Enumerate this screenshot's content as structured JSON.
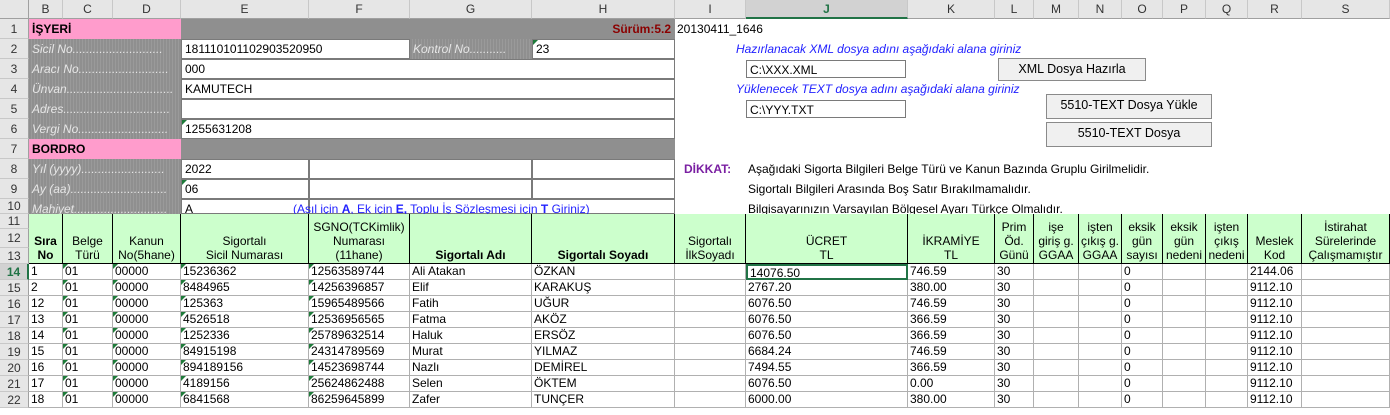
{
  "columns": [
    "B",
    "C",
    "D",
    "E",
    "F",
    "G",
    "H",
    "I",
    "J",
    "K",
    "L",
    "M",
    "N",
    "O",
    "P",
    "Q",
    "R",
    "S"
  ],
  "selected_column": "J",
  "row_numbers": [
    "1",
    "2",
    "3",
    "4",
    "5",
    "6",
    "7",
    "8",
    "9",
    "10",
    "11",
    "12",
    "13",
    "14",
    "15",
    "16",
    "17",
    "18",
    "19",
    "20",
    "21",
    "22"
  ],
  "selected_row": "14",
  "isyeri": {
    "title": "İŞYERİ",
    "sicil_label": "Sicil No...........................",
    "sicil_value": "181110101102903520950",
    "kontrol_label": "Kontrol No...........",
    "kontrol_value": "23",
    "araci_label": "Aracı No...........................",
    "araci_value": "000",
    "unvan_label": "Ünvan................................",
    "unvan_value": "KAMUTECH",
    "adres_label": "Adres................................",
    "adres_value": "",
    "vergi_label": "Vergi No...........................",
    "vergi_value": "1255631208"
  },
  "surum": "Sürüm:5.2",
  "build": "20130411_1646",
  "bordro": {
    "title": "BORDRO",
    "yil_label": "Yıl (yyyy).........................",
    "yil_value": "2022",
    "ay_label": "Ay (aa).............................",
    "ay_value": "06",
    "mahiyet_label": "Mahiyet............................",
    "mahiyet_value": "A",
    "mahiyet_note_a": "(Asıl için ",
    "mahiyet_note_b": "A",
    "mahiyet_note_c": ", Ek için ",
    "mahiyet_note_d": "E,",
    "mahiyet_note_e": " Toplu İş Sözleşmesi için ",
    "mahiyet_note_f": "T",
    "mahiyet_note_g": " Giriniz)"
  },
  "xml": {
    "hint": "Hazırlanacak XML dosya adını aşağıdaki alana giriniz",
    "path": "C:\\XXX.XML",
    "button": "XML Dosya Hazırla"
  },
  "text": {
    "hint": "Yüklenecek TEXT dosya adını aşağıdaki alana giriniz",
    "path": "C:\\YYY.TXT",
    "button_load": "5510-TEXT Dosya Yükle",
    "button_file": "5510-TEXT Dosya"
  },
  "dikkat": {
    "label": "DİKKAT:",
    "line1": "Aşağıdaki Sigorta Bilgileri Belge Türü ve Kanun Bazında Gruplu Girilmelidir.",
    "line2": "Sigortalı Bilgileri Arasında Boş Satır Bırakılmamalıdır.",
    "line3": "Bilgisayarınızın Varsayılan Bölgesel Ayarı Türkçe Olmalıdır."
  },
  "headers": [
    [
      "Sıra",
      "No"
    ],
    [
      "Belge",
      "Türü"
    ],
    [
      "Kanun",
      "No(5hane)"
    ],
    [
      "Sigortalı",
      "Sicil Numarası"
    ],
    [
      "SGNO(TCKimlik)",
      "Numarası (11hane)"
    ],
    [
      "Sigortalı Adı"
    ],
    [
      "Sigortalı Soyadı"
    ],
    [
      "Sigortalı",
      "İlkSoyadı"
    ],
    [
      "ÜCRET",
      "TL"
    ],
    [
      "İKRAMİYE",
      "TL"
    ],
    [
      "Prim",
      "Öd.",
      "Günü"
    ],
    [
      "işe",
      "giriş g.",
      "GGAA"
    ],
    [
      "işten",
      "çıkış g.",
      "GGAA"
    ],
    [
      "eksik",
      "gün",
      "sayısı"
    ],
    [
      "eksik",
      "gün",
      "nedeni"
    ],
    [
      "işten",
      "çıkış",
      "nedeni"
    ],
    [
      "Meslek",
      "Kod"
    ],
    [
      "İstirahat",
      "Sürelerinde",
      "Çalışmamıştır"
    ]
  ],
  "rows": [
    [
      "1",
      "01",
      "00000",
      "15236362",
      "12563589744",
      "Ali Atakan",
      "ÖZKAN",
      "",
      "14076.50",
      "746.59",
      "30",
      "",
      "",
      "0",
      "",
      "",
      "2144.06",
      ""
    ],
    [
      "2",
      "01",
      "00000",
      "8484965",
      "14256396857",
      "Elif",
      "KARAKUŞ",
      "",
      "2767.20",
      "380.00",
      "30",
      "",
      "",
      "0",
      "",
      "",
      "9112.10",
      ""
    ],
    [
      "12",
      "01",
      "00000",
      "125363",
      "15965489566",
      "Fatih",
      "UĞUR",
      "",
      "6076.50",
      "746.59",
      "30",
      "",
      "",
      "0",
      "",
      "",
      "9112.10",
      ""
    ],
    [
      "13",
      "01",
      "00000",
      "4526518",
      "12536956565",
      "Fatma",
      "AKÖZ",
      "",
      "6076.50",
      "366.59",
      "30",
      "",
      "",
      "0",
      "",
      "",
      "9112.10",
      ""
    ],
    [
      "14",
      "01",
      "00000",
      "1252336",
      "25789632514",
      "Haluk",
      "ERSÖZ",
      "",
      "6076.50",
      "366.59",
      "30",
      "",
      "",
      "0",
      "",
      "",
      "9112.10",
      ""
    ],
    [
      "15",
      "01",
      "00000",
      "84915198",
      "24314789569",
      "Murat",
      "YILMAZ",
      "",
      "6684.24",
      "746.59",
      "30",
      "",
      "",
      "0",
      "",
      "",
      "9112.10",
      ""
    ],
    [
      "16",
      "01",
      "00000",
      "894189156",
      "14523698744",
      "Nazlı",
      "DEMİREL",
      "",
      "7494.55",
      "366.59",
      "30",
      "",
      "",
      "0",
      "",
      "",
      "9112.10",
      ""
    ],
    [
      "17",
      "01",
      "00000",
      "4189156",
      "25624862488",
      "Selen",
      "ÖKTEM",
      "",
      "6076.50",
      "0.00",
      "30",
      "",
      "",
      "0",
      "",
      "",
      "9112.10",
      ""
    ],
    [
      "18",
      "01",
      "00000",
      "6841568",
      "86259645899",
      "Zafer",
      "TUNÇER",
      "",
      "6000.00",
      "380.00",
      "30",
      "",
      "",
      "0",
      "",
      "",
      "9112.10",
      ""
    ]
  ],
  "colors": {
    "pink": "#ff9ccc",
    "grey": "#8f8f8f",
    "header_green": "#ccffcc",
    "accent": "#217346",
    "note_blue": "#2222ff",
    "dikkat_purple": "#7a1fa2",
    "surum_red": "#8b0000"
  }
}
